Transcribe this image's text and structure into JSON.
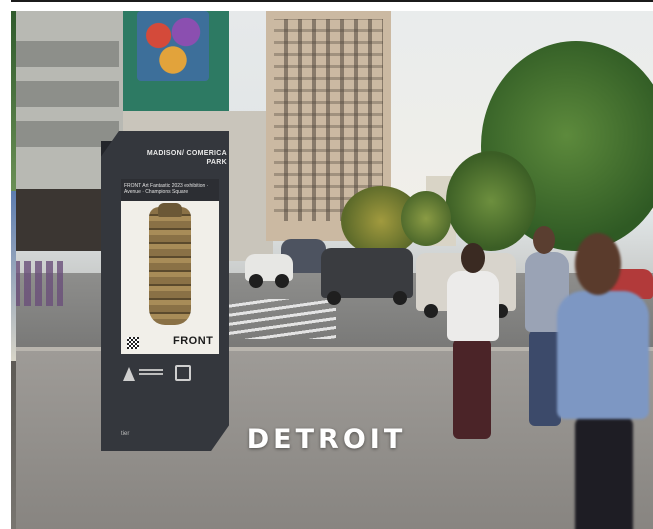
{
  "photo": {
    "caption": "DETROIT",
    "kiosk": {
      "label": "MADISON/ COMERICA PARK",
      "screen_heading": "FRONT Art Fantastic 2023 exhibition · Avenue · Champions Square",
      "screen_brand": "FRONT",
      "footer": "tier"
    }
  }
}
